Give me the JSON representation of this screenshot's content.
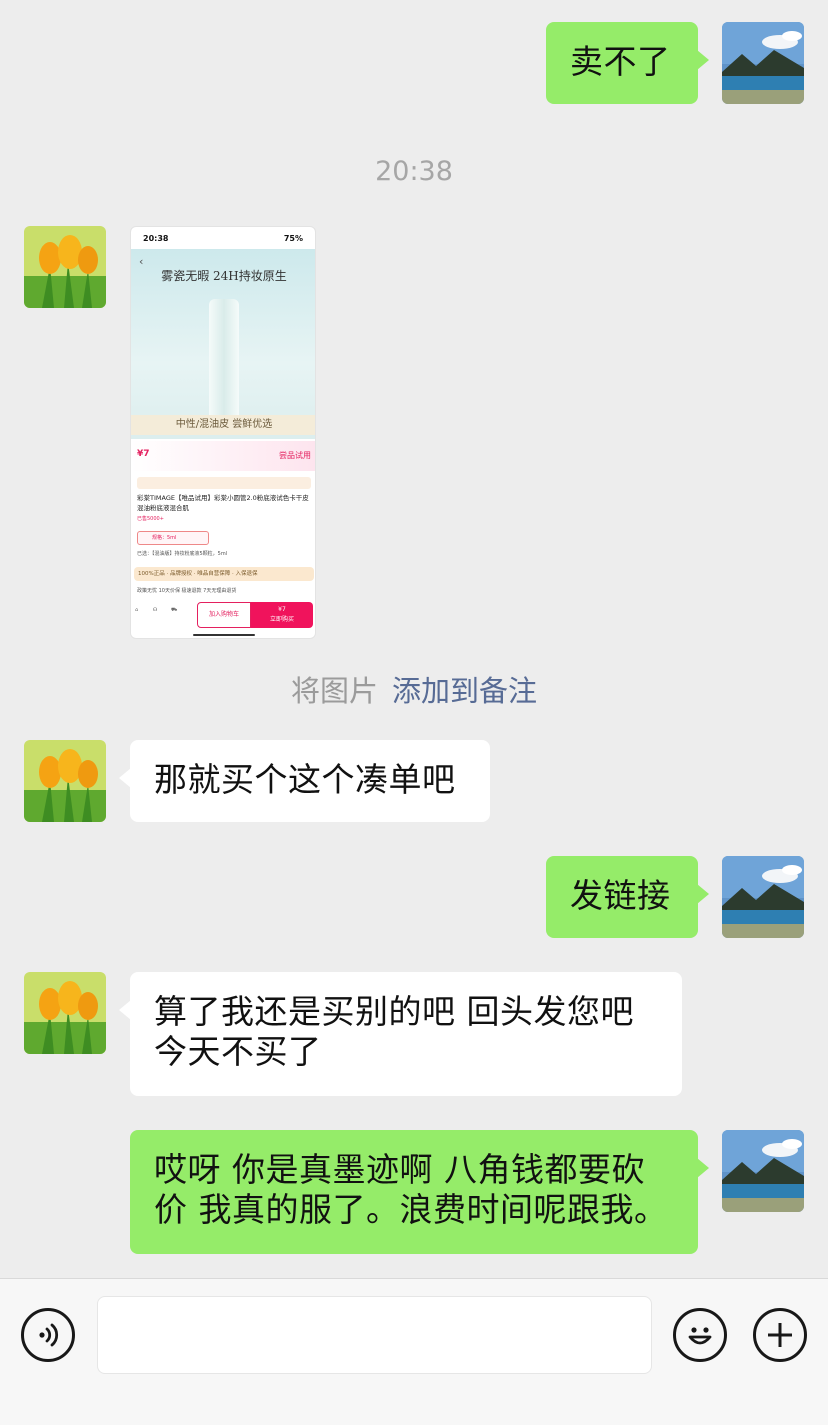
{
  "messages": {
    "m1": "卖不了",
    "time": "20:38",
    "note_prefix": "将图片",
    "note_link": "添加到备注",
    "m3": "那就买个这个凑单吧",
    "m4": "发链接",
    "m5_line1": "算了我还是买别的吧 回头发您吧",
    "m5_line2": "今天不买了",
    "m6_line1": "哎呀 你是真墨迹啊 八角钱都要砍",
    "m6_line2": "价 我真的服了。浪费时间呢跟我。"
  },
  "shared_image": {
    "status_time": "20:38",
    "status_battery": "75%",
    "headline": "雾瓷无暇 24H持妆原生",
    "band": "中性/混油皮 尝鲜优选",
    "price": "¥7",
    "trial_tag": "尝品试用",
    "title": "彩棠TIMAGE【唯品试用】彩棠小圆管2.0粉底液试色卡干皮混油粉底液混合肌",
    "sales": "已售5000+",
    "sku": "规格：5ml",
    "checked": "已选：【混油版】持妆粉底液5颗粒，5ml",
    "guarantee": "100%正品 · 品牌授权 · 唯品自营保障 · 入保退保",
    "shipping": "政策无忧 10天价保 极速退款 7天无理由退货",
    "add_cart": "加入购物车",
    "buy_price": "¥7",
    "buy_now": "立即购买"
  },
  "input": {
    "value": ""
  },
  "icons": {
    "voice": "voice-icon",
    "emoji": "emoji-icon",
    "plus": "plus-icon"
  },
  "colors": {
    "self_bubble": "#95ec69",
    "peer_bubble": "#ffffff",
    "background": "#ededed",
    "link": "#576b95"
  }
}
